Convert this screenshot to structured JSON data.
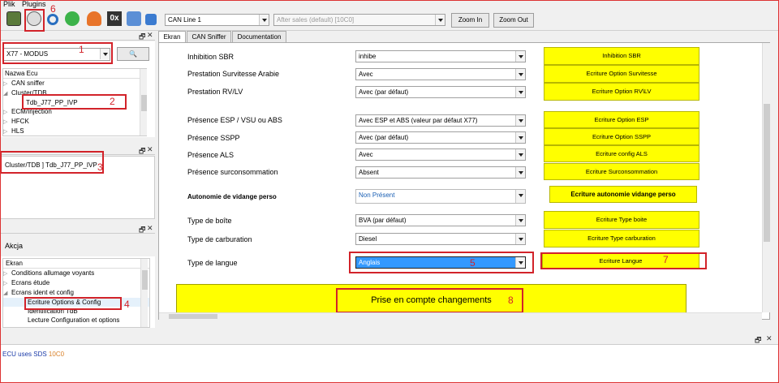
{
  "menu": {
    "file": "Plik",
    "plugins": "Plugins"
  },
  "toolbar": {
    "can_line": "CAN Line 1",
    "session": "After sales (default) [10C0]",
    "zoom_in": "Zoom In",
    "zoom_out": "Zoom Out",
    "hex_label": "0x"
  },
  "left_top": {
    "vehicle": "X77 - MODUS",
    "tree_header": "Nazwa Ecu",
    "items": [
      "CAN sniffer",
      "Cluster/TDB",
      "Tdb_J77_PP_IVP",
      "ECM/Injection",
      "HFCK",
      "HLS"
    ]
  },
  "left_mid": {
    "selected": "Cluster/TDB ] Tdb_J77_PP_IVP"
  },
  "left_bottom": {
    "title": "Akcja",
    "header": "Ekran",
    "items": [
      "Conditions allumage voyants",
      "Ecrans étude",
      "Ecrans ident et config",
      "Ecriture Options & Config",
      "Identification TdB",
      "Lecture Configuration et options"
    ]
  },
  "tabs": [
    "Ekran",
    "CAN Sniffer",
    "Documentation"
  ],
  "rows": [
    {
      "label": "Inhibition SBR",
      "value": "inhibe",
      "button": "Inhibition SBR"
    },
    {
      "label": "Prestation Survitesse Arabie",
      "value": "Avec",
      "button": "Ecriture Option Survitesse"
    },
    {
      "label": "Prestation RV/LV",
      "value": "Avec (par défaut)",
      "button": "Ecriture Option RV\\LV"
    },
    {
      "label": "Présence ESP / VSU ou ABS",
      "value": "Avec ESP et ABS (valeur par défaut X77)",
      "button": "Ecriture Option ESP"
    },
    {
      "label": "Présence SSPP",
      "value": "Avec (par défaut)",
      "button": "Ecriture Option SSPP"
    },
    {
      "label": "Présence ALS",
      "value": "Avec",
      "button": "Ecriture config ALS"
    },
    {
      "label": "Présence surconsommation",
      "value": "Absent",
      "button": "Ecriture Surconsommation"
    },
    {
      "label": "Autonomie de vidange perso",
      "value": "Non Présent",
      "button": "Ecriture autonomie vidange perso"
    },
    {
      "label": "Type de boîte",
      "value": "BVA (par défaut)",
      "button": "Ecriture Type boite"
    },
    {
      "label": "Type de carburation",
      "value": "Diesel",
      "button": "Ecriture Type carburation"
    },
    {
      "label": "Type de langue",
      "value": "Anglais",
      "button": "Ecriture Langue"
    }
  ],
  "apply_button": "Prise en compte changements",
  "annotations": [
    "1",
    "2",
    "3",
    "4",
    "5",
    "6",
    "7",
    "8"
  ],
  "log": {
    "text": "ECU uses SDS",
    "code": "10C0"
  },
  "colors": {
    "yellow": "#ffff00",
    "annotation_red": "#d2232a",
    "selection_blue": "#3399ff"
  }
}
